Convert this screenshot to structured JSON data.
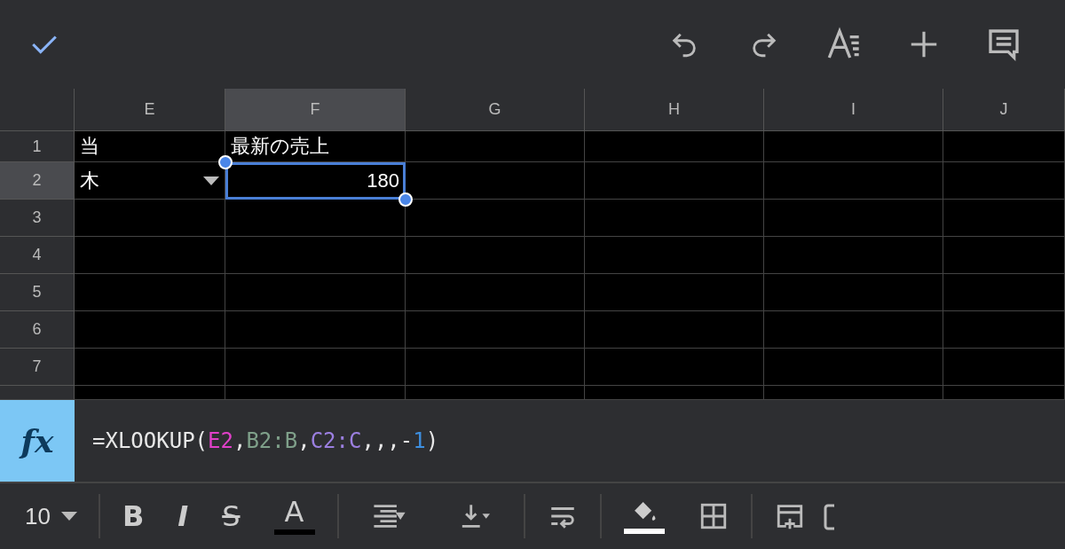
{
  "columns": [
    {
      "label": "E",
      "selected": false
    },
    {
      "label": "F",
      "selected": true
    },
    {
      "label": "G",
      "selected": false
    },
    {
      "label": "H",
      "selected": false
    },
    {
      "label": "I",
      "selected": false
    },
    {
      "label": "J",
      "selected": false
    }
  ],
  "rows": [
    {
      "label": "1",
      "selected": false,
      "cells": [
        {
          "text": "当",
          "align_right": false,
          "selected": false
        },
        {
          "text": "最新の売上",
          "align_right": false,
          "selected": false
        },
        {
          "selected": false
        },
        {
          "selected": false
        },
        {
          "selected": false
        },
        {
          "selected": false
        }
      ]
    },
    {
      "label": "2",
      "selected": true,
      "cells": [
        {
          "text": "木",
          "align_right": false,
          "dropdown": true,
          "selected": false
        },
        {
          "text": "180",
          "align_right": true,
          "selected": true
        },
        {
          "selected": false
        },
        {
          "selected": false
        },
        {
          "selected": false
        },
        {
          "selected": false
        }
      ]
    },
    {
      "label": "3",
      "selected": false
    },
    {
      "label": "4",
      "selected": false
    },
    {
      "label": "5",
      "selected": false
    },
    {
      "label": "6",
      "selected": false
    },
    {
      "label": "7",
      "selected": false
    }
  ],
  "formula_bar": {
    "label": "fx",
    "tokens": [
      {
        "text": "=XLOOKUP(",
        "color": "#e8e8e8"
      },
      {
        "text": "E2",
        "color": "#e040c8"
      },
      {
        "text": ",",
        "color": "#e8e8e8"
      },
      {
        "text": "B2:B",
        "color": "#7fa08a"
      },
      {
        "text": ",",
        "color": "#e8e8e8"
      },
      {
        "text": "C2:C",
        "color": "#9b7fe0"
      },
      {
        "text": ",,,-",
        "color": "#e8e8e8"
      },
      {
        "text": "1",
        "color": "#3d8fe0"
      },
      {
        "text": ")",
        "color": "#e8e8e8"
      }
    ]
  },
  "format_toolbar": [
    {
      "kind": "font-size",
      "text": "10"
    },
    {
      "kind": "divider"
    },
    {
      "kind": "bold",
      "text": "B"
    },
    {
      "kind": "italic",
      "text": "I"
    },
    {
      "kind": "strike",
      "text": "S"
    },
    {
      "kind": "text-color",
      "text": "A",
      "color": "#000000"
    },
    {
      "kind": "divider"
    },
    {
      "kind": "align-h"
    },
    {
      "kind": "align-v"
    },
    {
      "kind": "divider"
    },
    {
      "kind": "wrap"
    },
    {
      "kind": "divider"
    },
    {
      "kind": "fill-color",
      "color": "#ffffff"
    },
    {
      "kind": "borders"
    },
    {
      "kind": "divider"
    },
    {
      "kind": "insert"
    },
    {
      "kind": "cut"
    }
  ]
}
